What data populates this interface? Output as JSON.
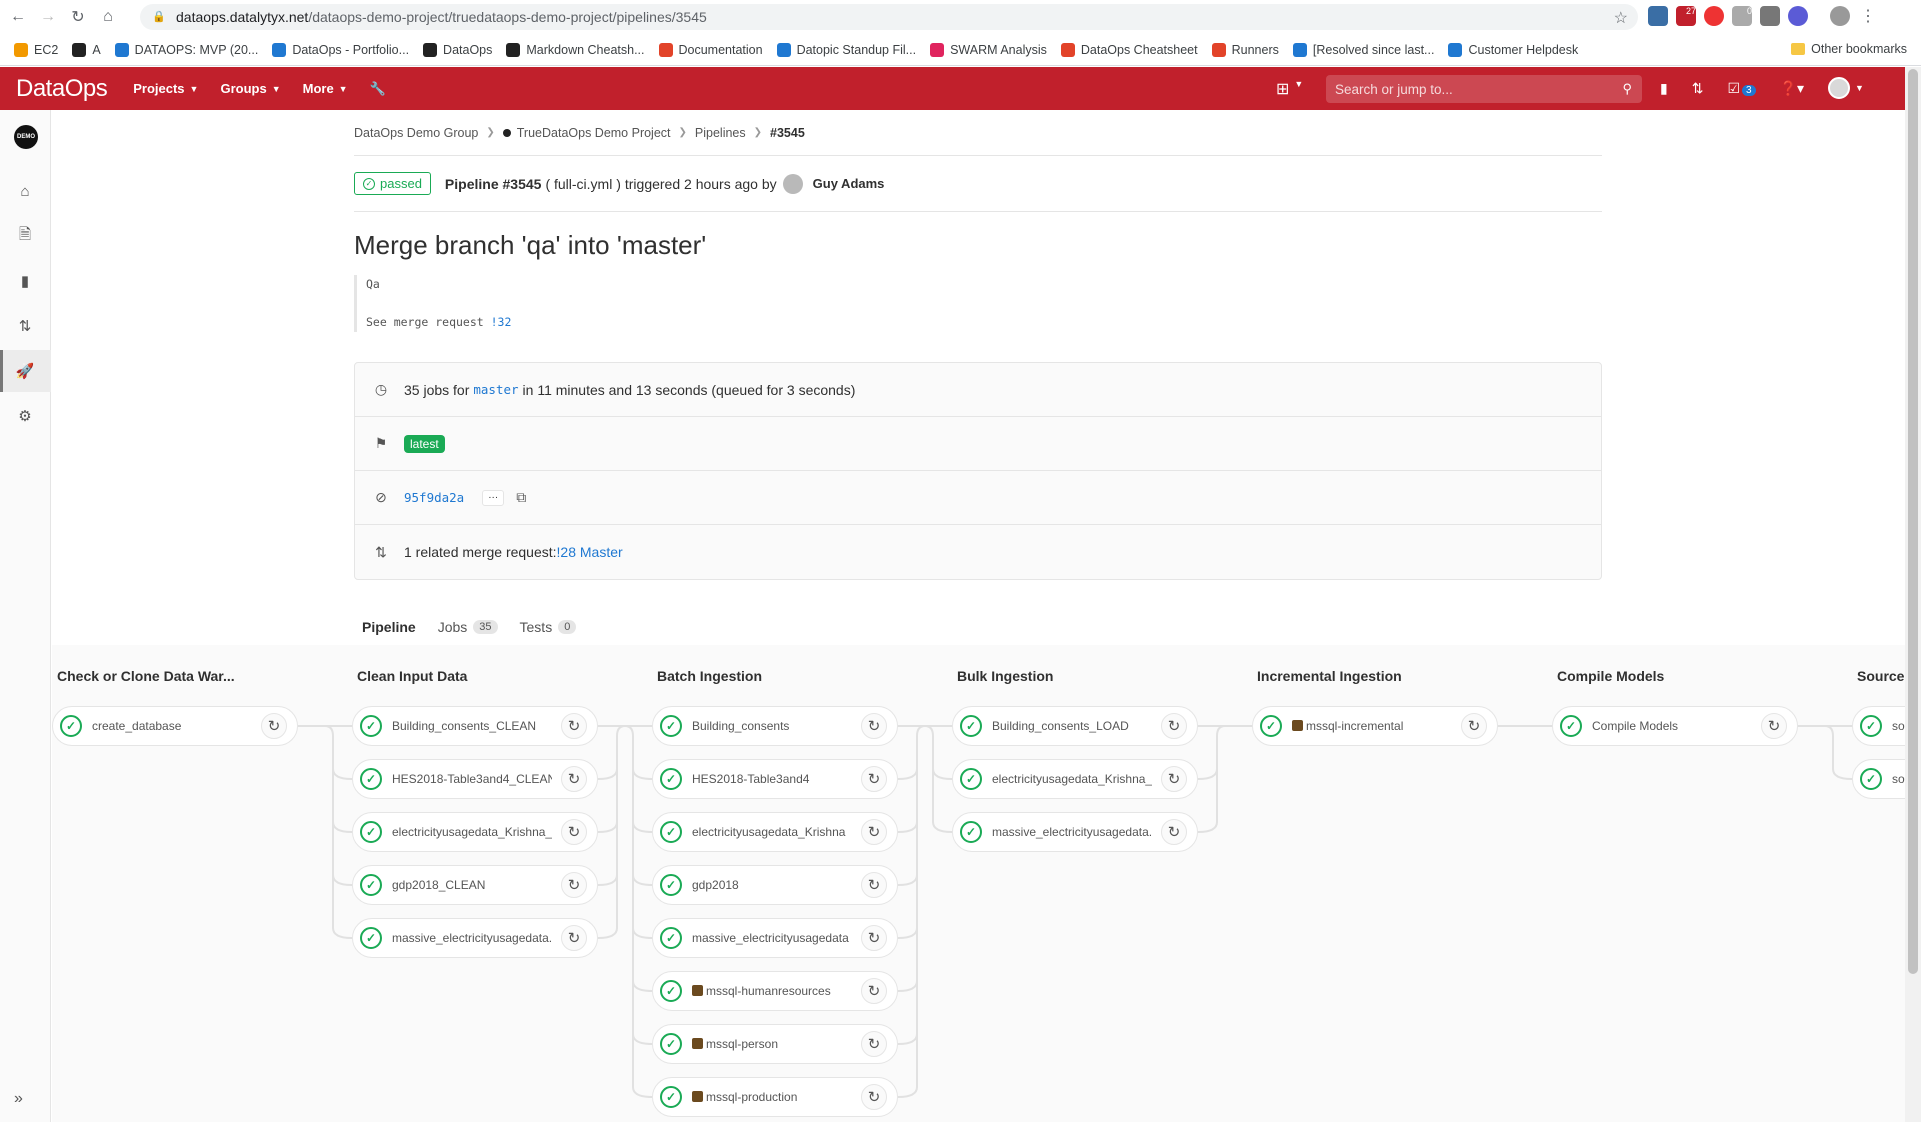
{
  "browser": {
    "url_host": "dataops.datalytyx.net",
    "url_path": "/dataops-demo-project/truedataops-demo-project/pipelines/3545",
    "bookmarks": [
      "EC2",
      "A",
      "DATAOPS: MVP (20...",
      "DataOps - Portfolio...",
      "DataOps",
      "Markdown Cheatsh...",
      "Documentation",
      "Datopic Standup Fil...",
      "SWARM Analysis",
      "DataOps Cheatsheet",
      "Runners",
      "[Resolved since last...",
      "Customer Helpdesk"
    ],
    "other_bookmarks": "Other bookmarks",
    "ext_badges": {
      "badge1": "27",
      "badge2": "0"
    }
  },
  "header": {
    "logo": "DataOps",
    "nav": [
      "Projects",
      "Groups",
      "More"
    ],
    "search_placeholder": "Search or jump to...",
    "todo_count": "3",
    "brand_color": "#c1202c"
  },
  "sidebar": {
    "project_avatar": "DEMO",
    "icons": [
      "home-icon",
      "document-icon",
      "issues-icon",
      "merge-request-icon",
      "rocket-icon",
      "settings-icon"
    ]
  },
  "breadcrumb": [
    "DataOps Demo Group",
    "TrueDataOps Demo Project",
    "Pipelines",
    "#3545"
  ],
  "pipeline": {
    "status": "passed",
    "id_label": "Pipeline #3545",
    "config": "( full-ci.yml )",
    "triggered_text": "triggered 2 hours ago by",
    "user": "Guy Adams",
    "title": "Merge branch 'qa' into 'master'",
    "commit_body_1": "Qa",
    "commit_body_2_prefix": "See merge request ",
    "commit_body_2_link": "!32",
    "jobs_prefix": "35 jobs for ",
    "branch": "master",
    "jobs_suffix": " in 11 minutes and 13 seconds (queued for 3 seconds)",
    "tag": "latest",
    "sha": "95f9da2a",
    "ellipsis": "···",
    "related_prefix": "1 related merge request: ",
    "related_link": "!28 Master"
  },
  "tabs": [
    {
      "label": "Pipeline",
      "count": ""
    },
    {
      "label": "Jobs",
      "count": "35"
    },
    {
      "label": "Tests",
      "count": "0"
    }
  ],
  "stages": [
    {
      "title": "Check or Clone Data War...",
      "jobs": [
        "create_database"
      ]
    },
    {
      "title": "Clean Input Data",
      "jobs": [
        "Building_consents_CLEAN",
        "HES2018-Table3and4_CLEAN",
        "electricityusagedata_Krishna_...",
        "gdp2018_CLEAN",
        "massive_electricityusagedata..."
      ]
    },
    {
      "title": "Batch Ingestion",
      "jobs": [
        "Building_consents",
        "HES2018-Table3and4",
        "electricityusagedata_Krishna",
        "gdp2018",
        "massive_electricityusagedata",
        "mssql-humanresources",
        "mssql-person",
        "mssql-production"
      ]
    },
    {
      "title": "Bulk Ingestion",
      "jobs": [
        "Building_consents_LOAD",
        "electricityusagedata_Krishna_...",
        "massive_electricityusagedata..."
      ]
    },
    {
      "title": "Incremental Ingestion",
      "jobs": [
        "mssql-incremental"
      ]
    },
    {
      "title": "Compile Models",
      "jobs": [
        "Compile Models"
      ]
    },
    {
      "title": "Source Doma",
      "jobs": [
        "source_",
        "source_"
      ]
    }
  ]
}
